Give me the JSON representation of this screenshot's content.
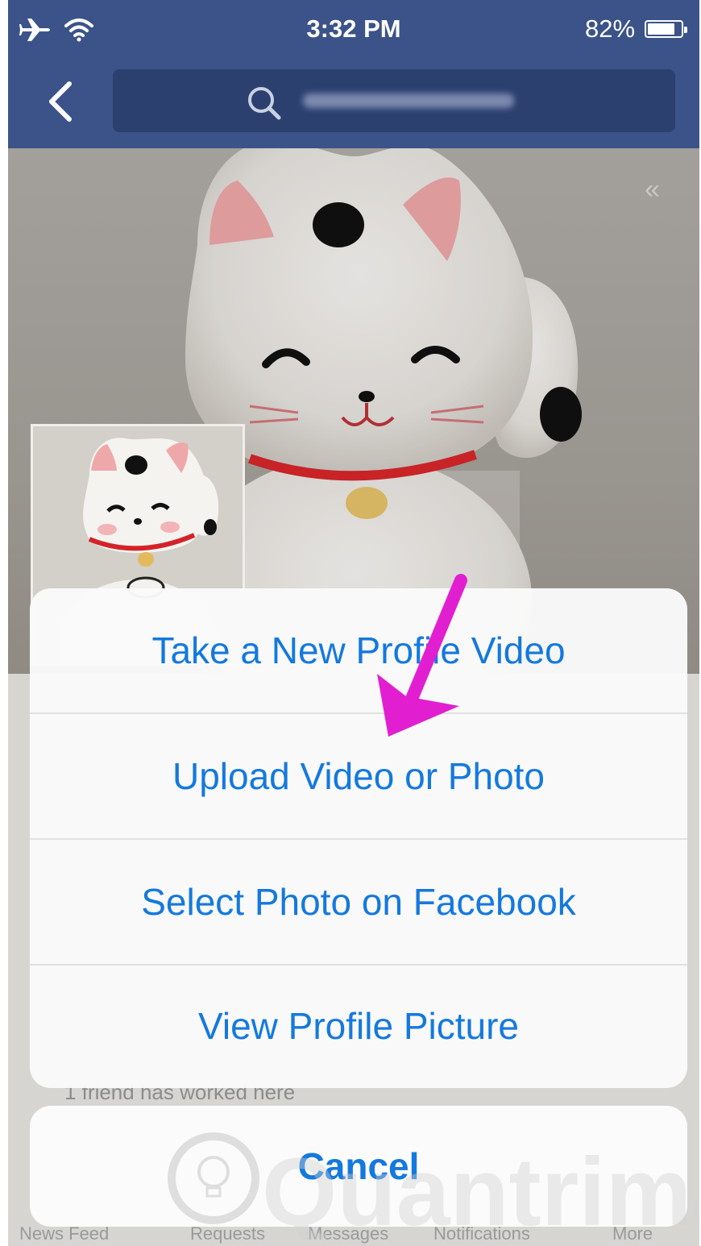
{
  "status_bar": {
    "time": "3:32 PM",
    "battery": "82%",
    "battery_level": 0.82,
    "icons": [
      "airplane-icon",
      "wifi-icon",
      "battery-icon"
    ]
  },
  "nav": {
    "back_icon": "chevron-left-icon",
    "search_icon": "search-icon"
  },
  "action_sheet": {
    "items": [
      {
        "label": "Take a New Profile Video"
      },
      {
        "label": "Upload Video or Photo"
      },
      {
        "label": "Select Photo on Facebook"
      },
      {
        "label": "View Profile Picture"
      }
    ],
    "cancel": "Cancel"
  },
  "background": {
    "info_text": "1 friend has worked here"
  },
  "tab_bar": {
    "items": [
      "News Feed",
      "Requests",
      "Messages",
      "Notifications",
      "More"
    ]
  },
  "watermark": {
    "text": "Quantrimang"
  },
  "colors": {
    "nav_bar": "#3b5388",
    "action_text": "#1479de",
    "annotation_arrow": "#e21fd0"
  }
}
